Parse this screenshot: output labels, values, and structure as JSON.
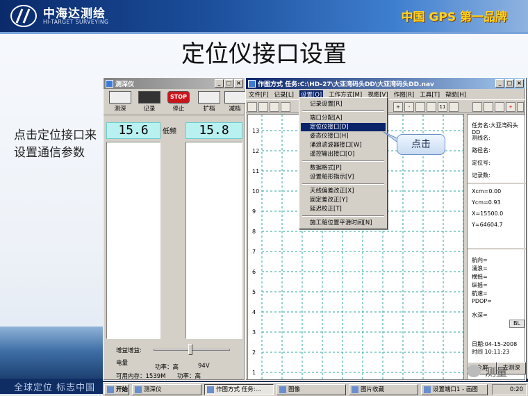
{
  "header": {
    "logo_cn": "中海达测绘",
    "logo_en": "HI-TARGET SURVEYING",
    "slogan": "中国 GPS 第一品牌"
  },
  "slide": {
    "title": "定位仪接口设置",
    "side_text": "点击定位接口来设置通信参数",
    "callout": "点击",
    "footer_text": "全球定位   标志中国",
    "watermark": "测量"
  },
  "sounder": {
    "title": "测深仪",
    "tools": [
      "测深",
      "记录",
      "停止",
      "扩档",
      "减档"
    ],
    "stop_icon_text": "STOP",
    "readout_left": "15.6",
    "readout_mode": "低频",
    "readout_right": "15.8",
    "gain_label": "增益增益:",
    "power_label": "电量",
    "power_text": "功率：高",
    "voltage": "94V",
    "memory": "可用内存：1539M",
    "power_text2": "功率：高"
  },
  "nav": {
    "title": "作图方式  任务:C:\\HD-27\\大亚湾码头DD\\大亚湾码头DD.nav",
    "menus": [
      "文件[F]",
      "记录[L]",
      "设置[O]",
      "工作方式[M]",
      "视图[V]",
      "作图[R]",
      "工具[T]",
      "帮助[H]"
    ],
    "y_labels": [
      "13",
      "12",
      "11",
      "10",
      "9",
      "8",
      "7",
      "6",
      "5",
      "4",
      "3",
      "2",
      "1"
    ],
    "info": {
      "task": "任务名:大亚湾码头DD",
      "line": "测线名:",
      "path": "路径名:",
      "fix": "定位号:",
      "count": "记录数:",
      "xcm": "Xcm=0.00",
      "ycm": "Ycm=0.93",
      "x": "X=15500.0",
      "y": "Y=64604.7",
      "depth": "水深=",
      "bl": "BL",
      "heading": "航向=",
      "heave": "涌浪=",
      "roll": "横摇=",
      "pitch": "纵摇=",
      "speed": "航速=",
      "pdop": "PDOP=",
      "date": "日期:04-15-2008",
      "time": "时间 10:11:23",
      "fullscreen": "全屏",
      "goto_sounder": "去测深"
    }
  },
  "dropdown": {
    "items": [
      "记录设置[R]",
      "端口分配[A]",
      "定位仪接口[D]",
      "姿态仪接口[H]",
      "涌浪滤波器接口[W]",
      "遥控输出接口[O]",
      "数据格式[P]",
      "设置船形指示[V]",
      "天线偏差改正[X]",
      "固定差改正[Y]",
      "延迟校正[T]",
      "施工船位置平滑时间[N]"
    ],
    "selected_index": 2
  },
  "taskbar": {
    "start": "开始",
    "tasks": [
      "测深仪",
      "作图方式  任务:...",
      "图像",
      "图片收藏",
      "设置端口1 - 画图"
    ],
    "clock": "0:20"
  }
}
